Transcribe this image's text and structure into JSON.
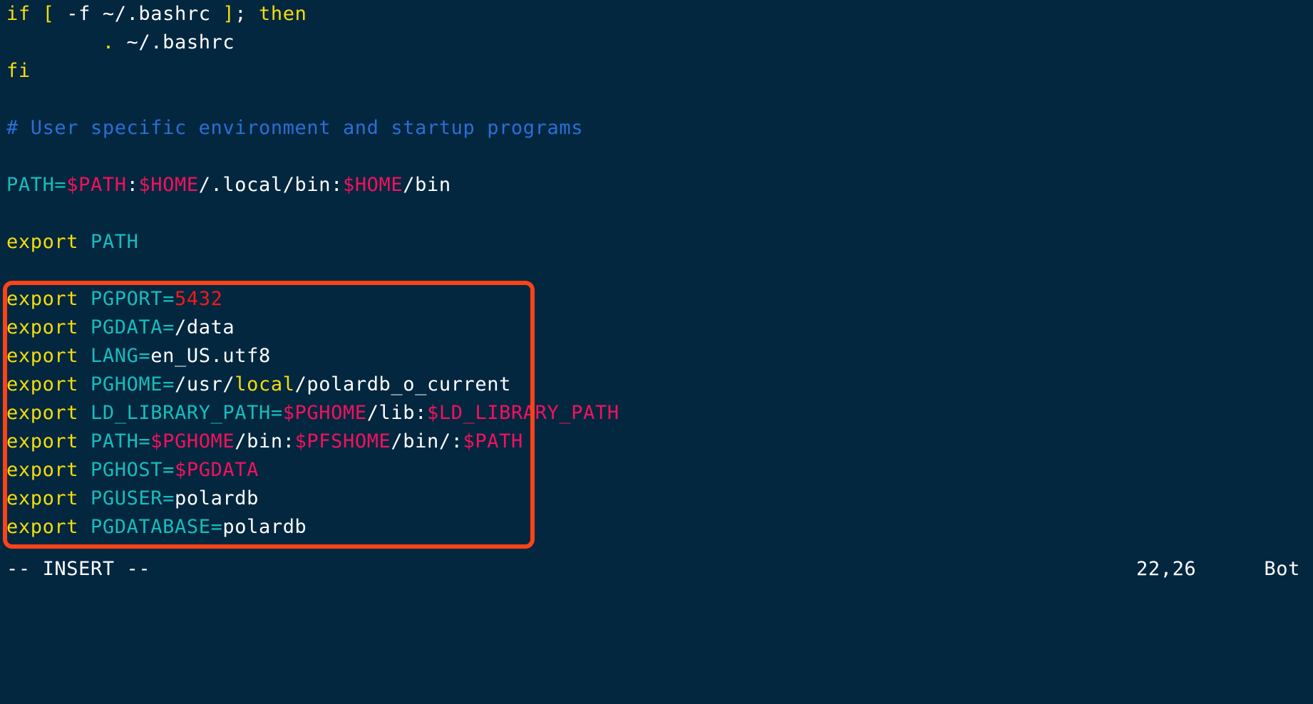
{
  "editor": {
    "name": "vim",
    "background_color": "#03273f",
    "foreground_color": "#ffffff"
  },
  "syntax_colors": {
    "keyword": "#f5dd0b",
    "identifier": "#16bdbd",
    "variable": "#f4115e",
    "comment": "#2a6fd6",
    "number": "#f21a1a",
    "text": "#ffffff"
  },
  "annotation": {
    "shape": "rounded-rectangle",
    "color": "#fc4318",
    "border_width_px": 6,
    "surrounds_lines": [
      "export PGPORT=5432",
      "export PGDATA=/data",
      "export LANG=en_US.utf8",
      "export PGHOME=/usr/local/polardb_o_current",
      "export LD_LIBRARY_PATH=$PGHOME/lib:$LD_LIBRARY_PATH",
      "export PATH=$PGHOME/bin:$PFSHOME/bin/:$PATH",
      "export PGHOST=$PGDATA",
      "export PGUSER=polardb",
      "export PGDATABASE=polardb"
    ]
  },
  "buffer": {
    "lines": [
      {
        "id": "line-if-bashrc",
        "tokens": [
          {
            "t": "if ",
            "c": "kw"
          },
          {
            "t": "[ ",
            "c": "kw"
          },
          {
            "t": "-f ~/.bashrc ",
            "c": "text"
          },
          {
            "t": "]",
            "c": "kw"
          },
          {
            "t": "; ",
            "c": "text"
          },
          {
            "t": "then",
            "c": "kw"
          }
        ]
      },
      {
        "id": "line-source-bashrc",
        "tokens": [
          {
            "t": "        ",
            "c": "text"
          },
          {
            "t": ".",
            "c": "kw"
          },
          {
            "t": " ~/.bashrc",
            "c": "text"
          }
        ]
      },
      {
        "id": "line-fi",
        "tokens": [
          {
            "t": "fi",
            "c": "kw"
          }
        ]
      },
      {
        "id": "line-blank-1",
        "tokens": [
          {
            "t": " ",
            "c": "text"
          }
        ]
      },
      {
        "id": "line-comment-user-env",
        "tokens": [
          {
            "t": "# User specific environment and startup programs",
            "c": "comment"
          }
        ]
      },
      {
        "id": "line-blank-2",
        "tokens": [
          {
            "t": " ",
            "c": "text"
          }
        ]
      },
      {
        "id": "line-path-assign",
        "tokens": [
          {
            "t": "PATH",
            "c": "ident"
          },
          {
            "t": "=",
            "c": "ident"
          },
          {
            "t": "$PATH",
            "c": "var"
          },
          {
            "t": ":",
            "c": "text"
          },
          {
            "t": "$HOME",
            "c": "var"
          },
          {
            "t": "/.local/bin:",
            "c": "text"
          },
          {
            "t": "$HOME",
            "c": "var"
          },
          {
            "t": "/bin",
            "c": "text"
          }
        ]
      },
      {
        "id": "line-blank-3",
        "tokens": [
          {
            "t": " ",
            "c": "text"
          }
        ]
      },
      {
        "id": "line-export-path",
        "tokens": [
          {
            "t": "export",
            "c": "kw"
          },
          {
            "t": " ",
            "c": "text"
          },
          {
            "t": "PATH",
            "c": "ident"
          }
        ]
      },
      {
        "id": "line-blank-4",
        "tokens": [
          {
            "t": " ",
            "c": "text"
          }
        ]
      },
      {
        "id": "line-export-pgport",
        "tokens": [
          {
            "t": "export",
            "c": "kw"
          },
          {
            "t": " ",
            "c": "text"
          },
          {
            "t": "PGPORT",
            "c": "ident"
          },
          {
            "t": "=",
            "c": "ident"
          },
          {
            "t": "5432",
            "c": "num"
          }
        ]
      },
      {
        "id": "line-export-pgdata",
        "tokens": [
          {
            "t": "export",
            "c": "kw"
          },
          {
            "t": " ",
            "c": "text"
          },
          {
            "t": "PGDATA",
            "c": "ident"
          },
          {
            "t": "=",
            "c": "ident"
          },
          {
            "t": "/data",
            "c": "text"
          }
        ]
      },
      {
        "id": "line-export-lang",
        "tokens": [
          {
            "t": "export",
            "c": "kw"
          },
          {
            "t": " ",
            "c": "text"
          },
          {
            "t": "LANG",
            "c": "ident"
          },
          {
            "t": "=",
            "c": "ident"
          },
          {
            "t": "en_US.utf8",
            "c": "text"
          }
        ]
      },
      {
        "id": "line-export-pghome",
        "tokens": [
          {
            "t": "export",
            "c": "kw"
          },
          {
            "t": " ",
            "c": "text"
          },
          {
            "t": "PGHOME",
            "c": "ident"
          },
          {
            "t": "=",
            "c": "ident"
          },
          {
            "t": "/usr/",
            "c": "text"
          },
          {
            "t": "local",
            "c": "kw"
          },
          {
            "t": "/polardb_o_current",
            "c": "text"
          }
        ]
      },
      {
        "id": "line-export-ld-library-path",
        "tokens": [
          {
            "t": "export",
            "c": "kw"
          },
          {
            "t": " ",
            "c": "text"
          },
          {
            "t": "LD_LIBRARY_PATH",
            "c": "ident"
          },
          {
            "t": "=",
            "c": "ident"
          },
          {
            "t": "$PGHOME",
            "c": "var"
          },
          {
            "t": "/lib:",
            "c": "text"
          },
          {
            "t": "$LD_LIBRARY_PATH",
            "c": "var"
          }
        ]
      },
      {
        "id": "line-export-path-pg",
        "tokens": [
          {
            "t": "export",
            "c": "kw"
          },
          {
            "t": " ",
            "c": "text"
          },
          {
            "t": "PATH",
            "c": "ident"
          },
          {
            "t": "=",
            "c": "ident"
          },
          {
            "t": "$PGHOME",
            "c": "var"
          },
          {
            "t": "/bin:",
            "c": "text"
          },
          {
            "t": "$PFSHOME",
            "c": "var"
          },
          {
            "t": "/bin/:",
            "c": "text"
          },
          {
            "t": "$PATH",
            "c": "var"
          }
        ]
      },
      {
        "id": "line-export-pghost",
        "tokens": [
          {
            "t": "export",
            "c": "kw"
          },
          {
            "t": " ",
            "c": "text"
          },
          {
            "t": "PGHOST",
            "c": "ident"
          },
          {
            "t": "=",
            "c": "ident"
          },
          {
            "t": "$PGDATA",
            "c": "var"
          }
        ]
      },
      {
        "id": "line-export-pguser",
        "tokens": [
          {
            "t": "export",
            "c": "kw"
          },
          {
            "t": " ",
            "c": "text"
          },
          {
            "t": "PGUSER",
            "c": "ident"
          },
          {
            "t": "=",
            "c": "ident"
          },
          {
            "t": "polardb",
            "c": "text"
          }
        ]
      },
      {
        "id": "line-export-pgdatabase",
        "tokens": [
          {
            "t": "export",
            "c": "kw"
          },
          {
            "t": " ",
            "c": "text"
          },
          {
            "t": "PGDATABASE",
            "c": "ident"
          },
          {
            "t": "=",
            "c": "ident"
          },
          {
            "t": "polardb",
            "c": "text"
          }
        ]
      }
    ]
  },
  "status": {
    "mode": "-- INSERT --",
    "position": "22,26",
    "scroll": "Bot"
  }
}
